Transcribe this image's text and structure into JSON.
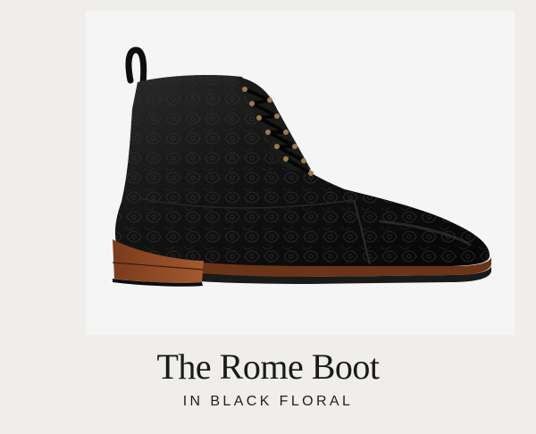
{
  "product": {
    "title": "The Rome Boot",
    "subtitle": "IN BLACK FLORAL"
  },
  "image": {
    "icon": "boot-image"
  },
  "colors": {
    "page_background": "#efeeea",
    "image_background": "#f5f5f5",
    "leather": "#111111",
    "sole_welt": "#7a3a1e",
    "text": "#1a1a1a"
  }
}
